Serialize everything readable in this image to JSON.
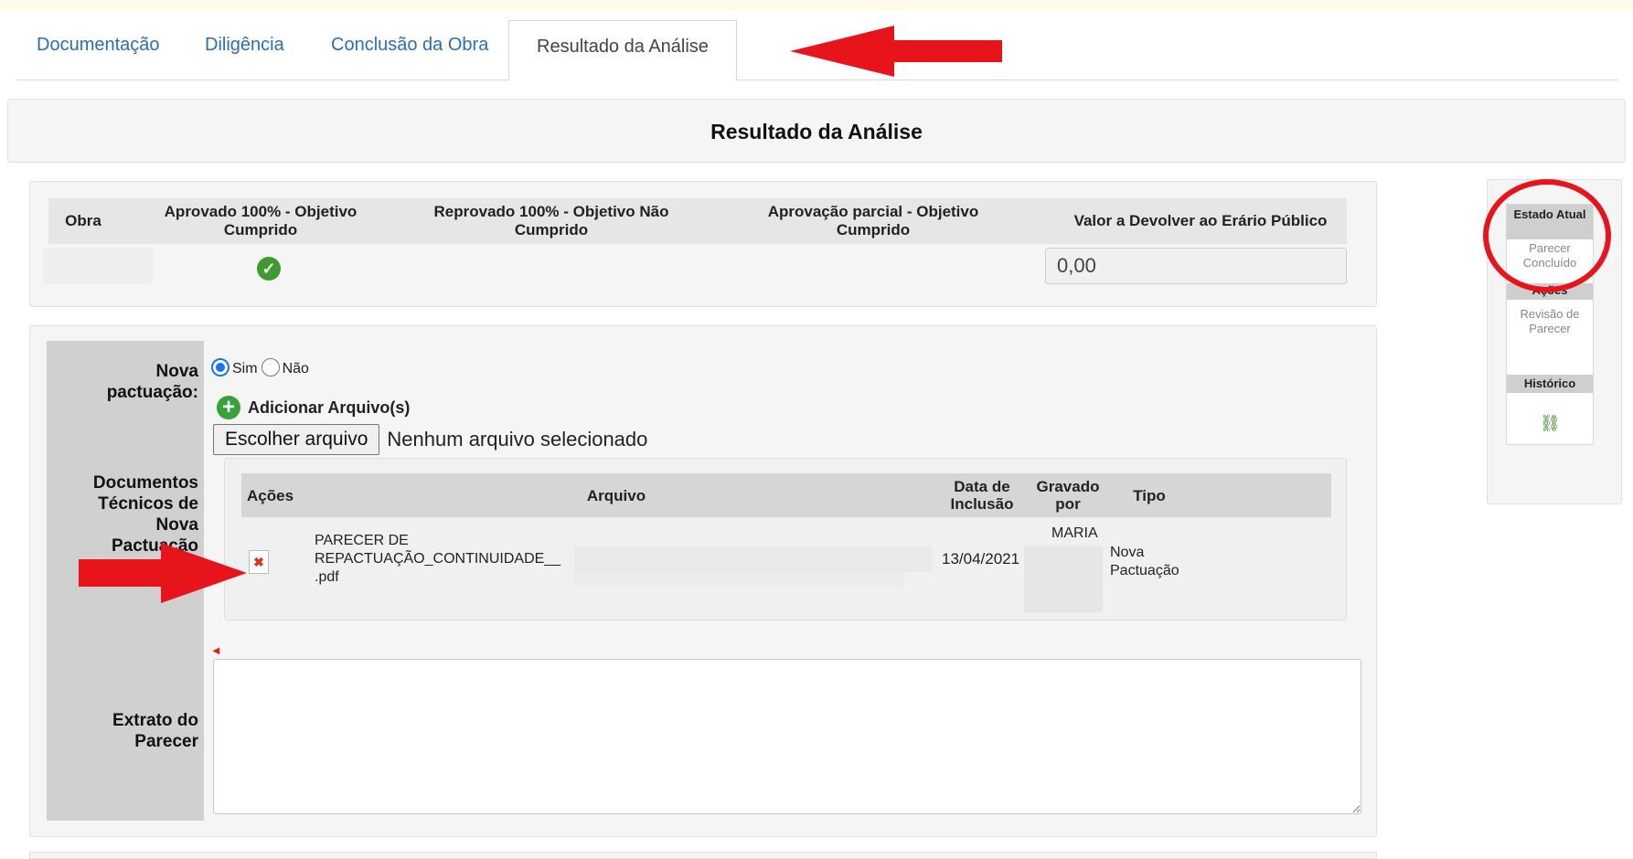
{
  "tabs": [
    {
      "label": "Documentação"
    },
    {
      "label": "Diligência"
    },
    {
      "label": "Conclusão da Obra"
    },
    {
      "label": "Resultado da Análise"
    }
  ],
  "section_title": "Resultado da Análise",
  "result_table": {
    "headers": {
      "obra": "Obra",
      "aprovado": "Aprovado 100% - Objetivo Cumprido",
      "reprovado": "Reprovado 100% - Objetivo Não Cumprido",
      "parcial": "Aprovação parcial - Objetivo Cumprido",
      "valor": "Valor a Devolver ao Erário Público"
    },
    "selected": "aprovado",
    "valor_devolver": "0,00"
  },
  "form": {
    "nova_pactuacao_label": "Nova pactuação:",
    "radio_sim": "Sim",
    "radio_nao": "Não",
    "radio_selected": "Sim",
    "add_files_label": "Adicionar Arquivo(s)",
    "choose_file_button": "Escolher arquivo",
    "no_file_text": "Nenhum arquivo selecionado",
    "documentos_label": "Documentos Técnicos de Nova Pactuação",
    "extrato_label": "Extrato do Parecer"
  },
  "documents": {
    "columns": [
      "Ações",
      "Arquivo",
      "Data de Inclusão",
      "Gravado por",
      "Tipo"
    ],
    "rows": [
      {
        "arquivo": "PARECER DE REPACTUAÇÃO_CONTINUIDADE__ .pdf",
        "data": "13/04/2021",
        "gravado_por": "MARIA",
        "tipo": "Nova Pactuação"
      }
    ]
  },
  "side_panel": {
    "estado_atual_label": "Estado Atual",
    "estado_atual_value": "Parecer Concluído",
    "acoes_label": "Ações",
    "acoes_value": "Revisão de Parecer",
    "historico_label": "Histórico"
  },
  "colors": {
    "tab_link": "#2a6fb5",
    "annotation_red": "#e8141b",
    "check_green": "#3d9b2f"
  }
}
